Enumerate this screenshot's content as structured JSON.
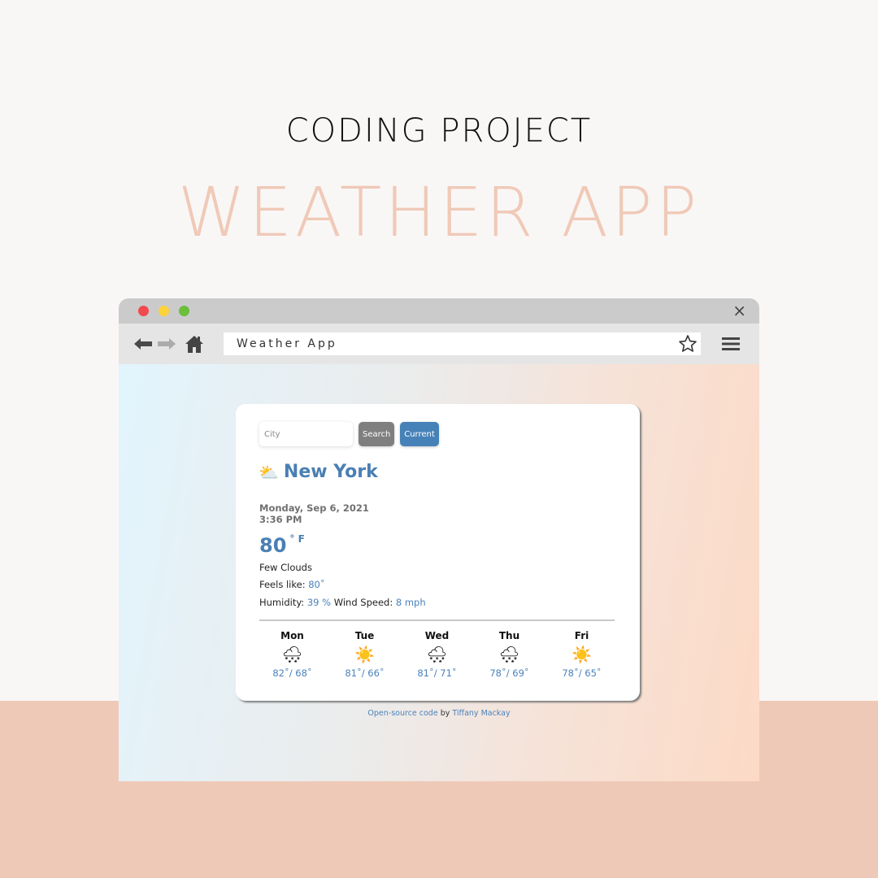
{
  "poster": {
    "headline": "CODING PROJECT",
    "title": "WEATHER APP"
  },
  "browser": {
    "window_controls": [
      "close-dot",
      "minimize-dot",
      "maximize-dot"
    ],
    "url_text": "Weather App",
    "icons": {
      "close": "×",
      "star": "star-outline",
      "menu": "hamburger"
    }
  },
  "app": {
    "city_placeholder": "City",
    "search_label": "Search",
    "current_label": "Current",
    "city_icon": "⛅",
    "city_name": "New York",
    "date": "Monday, Sep 6, 2021",
    "time": "3:36 PM",
    "temperature": "80",
    "temperature_unit": "° F",
    "description": "Few Clouds",
    "feels_like_label": "Feels like:",
    "feels_like_value": "80˚",
    "humidity_label": "Humidity:",
    "humidity_value": "39 %",
    "wind_label": "Wind Speed:",
    "wind_value": "8 mph",
    "forecast": [
      {
        "day": "Mon",
        "icon": "🌨",
        "icon_name": "rain-snow-cloud-icon",
        "temps": "82˚/ 68˚"
      },
      {
        "day": "Tue",
        "icon": "☀️",
        "icon_name": "sun-icon",
        "temps": "81˚/ 66˚"
      },
      {
        "day": "Wed",
        "icon": "🌨",
        "icon_name": "rain-snow-cloud-icon",
        "temps": "81˚/ 71˚"
      },
      {
        "day": "Thu",
        "icon": "🌨",
        "icon_name": "rain-snow-cloud-icon",
        "temps": "78˚/ 69˚"
      },
      {
        "day": "Fri",
        "icon": "☀️",
        "icon_name": "sun-icon",
        "temps": "78˚/ 65˚"
      }
    ],
    "footer": {
      "link_text": "Open-source code",
      "by": " by ",
      "author": "Tiffany Mackay"
    }
  },
  "colors": {
    "accent_blue": "#4682b8",
    "peach": "#f0c9b7",
    "search_gray": "#7f7f7f"
  }
}
